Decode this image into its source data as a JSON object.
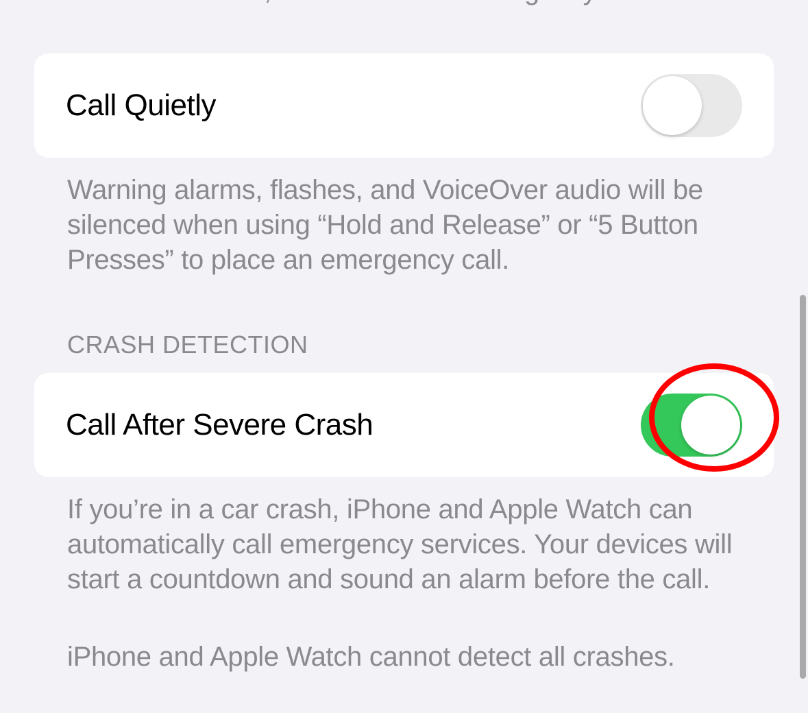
{
  "partial_top_text": "countdown ends, iPhone will call emergency services.",
  "call_quietly": {
    "label": "Call Quietly",
    "enabled": false,
    "description": "Warning alarms, flashes, and VoiceOver audio will be silenced when using “Hold and Release” or “5 Button Presses” to place an emergency call."
  },
  "crash_detection": {
    "header": "CRASH DETECTION",
    "label": "Call After Severe Crash",
    "enabled": true,
    "description": "If you’re in a car crash, iPhone and Apple Watch can automatically call emergency services. Your devices will start a countdown and sound an alarm before the call.",
    "disclaimer": "iPhone and Apple Watch cannot detect all crashes."
  },
  "annotation": {
    "highlight_color": "#ff0000"
  }
}
